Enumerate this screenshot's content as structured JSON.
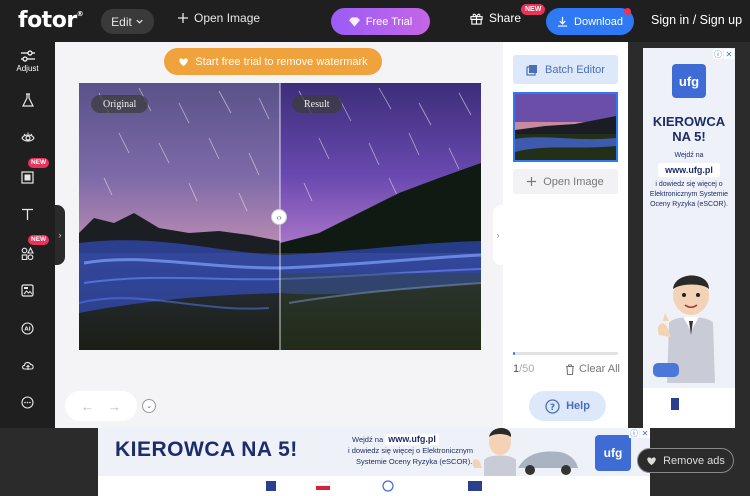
{
  "header": {
    "logo": "fotor",
    "logo_mark": "®",
    "edit_label": "Edit",
    "open_image_label": "Open Image",
    "free_trial_label": "Free Trial",
    "share_label": "Share",
    "share_badge": "NEW",
    "download_label": "Download",
    "signin_label": "Sign in / Sign up"
  },
  "sidebar": {
    "items": [
      {
        "label": "Adjust",
        "icon": "sliders-icon"
      },
      {
        "label": "",
        "icon": "flask-icon"
      },
      {
        "label": "",
        "icon": "eye-icon"
      },
      {
        "label": "",
        "icon": "frame-icon",
        "badge": "NEW"
      },
      {
        "label": "",
        "icon": "text-icon"
      },
      {
        "label": "",
        "icon": "elements-icon",
        "badge": "NEW"
      },
      {
        "label": "",
        "icon": "upload-image-icon"
      },
      {
        "label": "",
        "icon": "ai-icon"
      },
      {
        "label": "",
        "icon": "cloud-icon"
      },
      {
        "label": "",
        "icon": "more-icon"
      }
    ]
  },
  "canvas": {
    "watermark_label": "Start free trial to remove watermark",
    "original_tag": "Original",
    "result_tag": "Result"
  },
  "right_panel": {
    "batch_editor_label": "Batch Editor",
    "open_image_label": "Open Image",
    "count_current": "1",
    "count_total": "/50",
    "progress_fraction": 0.02,
    "clear_all_label": "Clear All",
    "help_label": "Help"
  },
  "ad_right": {
    "logo": "ufg",
    "headline": "KIEROWCA NA 5!",
    "line1": "Wejdź na",
    "url": "www.ufg.pl",
    "line2": "i dowiedz się więcej o Elektronicznym Systemie Oceny Ryzyka (eSCOR)."
  },
  "ad_bottom": {
    "headline": "KIEROWCA NA 5!",
    "line1": "Wejdź na",
    "url": "www.ufg.pl",
    "line2": "i dowiedz się więcej o Elektronicznym",
    "line3": "Systemie Oceny Ryzyka (eSCOR).",
    "logo": "ufg"
  },
  "remove_ads_label": "Remove ads",
  "colors": {
    "accent": "#2f79f4",
    "trial": "#b55ff0",
    "watermark": "#f0a23c",
    "badge": "#e8345a"
  }
}
